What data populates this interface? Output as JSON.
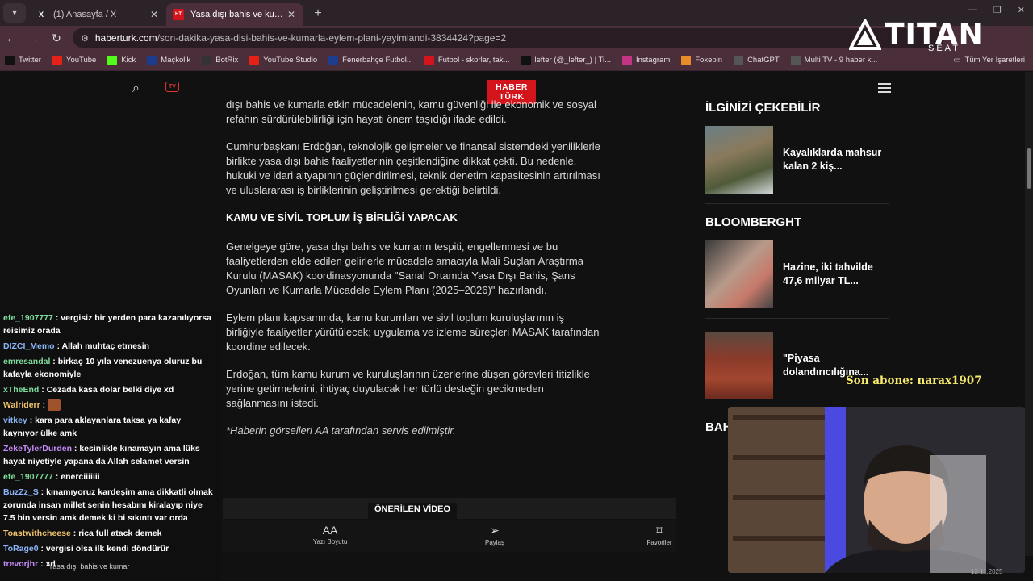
{
  "browser": {
    "tabs": [
      {
        "title": "(1) Anasayfa / X",
        "icon": "x-logo-icon"
      },
      {
        "title": "Yasa dışı bahis ve kumarla eylem",
        "icon": "haberturk-icon"
      }
    ],
    "url_host": "haberturk.com",
    "url_path": "/son-dakika-yasa-disi-bahis-ve-kumarla-eylem-plani-yayimlandi-3834424?page=2",
    "bookmarks": [
      {
        "label": "Twitter",
        "color": "#111111"
      },
      {
        "label": "YouTube",
        "color": "#e62117"
      },
      {
        "label": "Kick",
        "color": "#53fc18"
      },
      {
        "label": "Maçkolik",
        "color": "#1d3c8e"
      },
      {
        "label": "BotRix",
        "color": "#333333"
      },
      {
        "label": "YouTube Studio",
        "color": "#e62117"
      },
      {
        "label": "Fenerbahçe Futbol...",
        "color": "#1d3c8e"
      },
      {
        "label": "Futbol - skorlar, tak...",
        "color": "#d3151b"
      },
      {
        "label": "lefter (@_lefter_) | Ti...",
        "color": "#111111"
      },
      {
        "label": "Instagram",
        "color": "#c13584"
      },
      {
        "label": "Foxepin",
        "color": "#e88d2a"
      },
      {
        "label": "ChatGPT",
        "color": "#555555"
      },
      {
        "label": "Multi TV - 9 haber k...",
        "color": "#555555"
      }
    ],
    "all_bookmarks": "Tüm Yer İşaretleri"
  },
  "site": {
    "logo_line1": "HABER",
    "logo_line2": "TÜRK",
    "tv_badge": "TV"
  },
  "article": {
    "p1": "dışı bahis ve kumarla etkin mücadelenin, kamu güvenliği ile ekonomik ve sosyal refahın sürdürülebilirliği için hayati önem taşıdığı ifade edildi.",
    "p2": "Cumhurbaşkanı Erdoğan, teknolojik gelişmeler ve finansal sistemdeki yeniliklerle birlikte yasa dışı bahis faaliyetlerinin çeşitlendiğine dikkat çekti. Bu nedenle, hukuki ve idari altyapının güçlendirilmesi, teknik denetim kapasitesinin artırılması ve uluslararası iş birliklerinin geliştirilmesi gerektiği belirtildi.",
    "heading": "KAMU VE SİVİL TOPLUM İŞ BİRLİĞİ YAPACAK",
    "p3": "Genelgeye göre, yasa dışı bahis ve kumarın tespiti, engellenmesi ve bu faaliyetlerden elde edilen gelirlerle mücadele amacıyla Mali Suçları Araştırma Kurulu (MASAK) koordinasyonunda \"Sanal Ortamda Yasa Dışı Bahis, Şans Oyunları ve Kumarla Mücadele Eylem Planı (2025–2026)\" hazırlandı.",
    "p4": "Eylem planı kapsamında, kamu kurumları ve sivil toplum kuruluşlarının iş birliğiyle faaliyetler yürütülecek; uygulama ve izleme süreçleri MASAK tarafından koordine edilecek.",
    "p5": "Erdoğan, tüm kamu kurum ve kuruluşlarının üzerlerine düşen görevleri titizlikle yerine getirmelerini, ihtiyaç duyulacak her türlü desteğin gecikmeden sağlanmasını istedi.",
    "credit": "*Haberin görselleri AA tarafından servis edilmiştir.",
    "video_label": "ÖNERİLEN VİDEO"
  },
  "bottombar": {
    "font_size": "Yazı Boyutu",
    "share": "Paylaş",
    "favorites": "Favoriler",
    "font_icon": "AA"
  },
  "sidebar": {
    "section1": "İLGİNİZİ ÇEKEBİLİR",
    "card1": "Kayalıklarda mahsur kalan 2 kiş...",
    "section2": "BLOOMBERGHT",
    "card2": "Hazine, iki tahvilde 47,6 milyar TL...",
    "card3": "\"Piyasa dolandırıcılığına...",
    "section3_partial": "BAH"
  },
  "overlay": {
    "brand": "TITAN",
    "brand_sub": "SEAT",
    "sub_alert": "Son abone: narax1907",
    "taskbar_hint": "Yasa dışı bahis ve kumar",
    "taskbar_date": "12.11.2025",
    "sayfa_hint": "Sayfa"
  },
  "chat": [
    {
      "user": "efe_1907777",
      "color": "#7ddc9a",
      "text": "vergisiz bir yerden para kazanılıyorsa reisimiz orada"
    },
    {
      "user": "DIZCI_Memo",
      "color": "#8ab4f8",
      "text": "Allah muhtaç etmesin"
    },
    {
      "user": "emresandal",
      "color": "#7ddc9a",
      "text": "birkaç 10 yıla venezuenya oluruz bu kafayla ekonomiyle"
    },
    {
      "user": "xTheEnd",
      "color": "#7ddc9a",
      "text": "Cezada kasa dolar belki diye xd"
    },
    {
      "user": "Walriderr",
      "color": "#f0c36d",
      "text": ""
    },
    {
      "user": "vitkey",
      "color": "#8ab4f8",
      "text": "kara para aklayanlara taksa ya kafay kaynıyor ülke amk"
    },
    {
      "user": "ZekeTylerDurden",
      "color": "#c58af9",
      "text": "kesinlikle kınamayın ama lüks hayat niyetiyle yapana da Allah selamet versin"
    },
    {
      "user": "efe_1907777",
      "color": "#7ddc9a",
      "text": "enerciiiiiii"
    },
    {
      "user": "BuzZz_S",
      "color": "#8ab4f8",
      "text": "kınamıyoruz kardeşim ama dikkatli olmak zorunda insan millet senin hesabını kiralayıp niye 7.5 bin versin amk demek ki bi sıkıntı var orda"
    },
    {
      "user": "Toastwithcheese",
      "color": "#f0c36d",
      "text": "rica full atack demek"
    },
    {
      "user": "ToRage0",
      "color": "#8ab4f8",
      "text": "vergisi olsa ilk kendi döndürür"
    },
    {
      "user": "trevorjhr",
      "color": "#c58af9",
      "text": "xd"
    }
  ]
}
